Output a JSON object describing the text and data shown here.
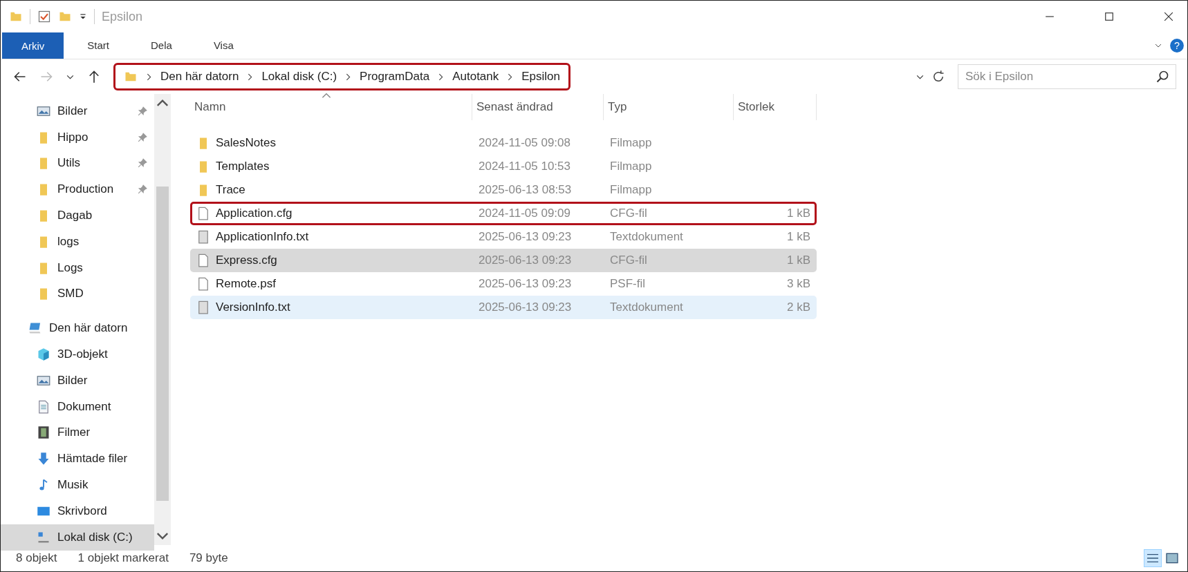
{
  "window": {
    "title": "Epsilon"
  },
  "ribbon": {
    "help": "?",
    "tabs": [
      {
        "label": "Arkiv",
        "selected": true
      },
      {
        "label": "Start",
        "selected": false
      },
      {
        "label": "Dela",
        "selected": false
      },
      {
        "label": "Visa",
        "selected": false
      }
    ]
  },
  "address_bar": {
    "annotated": true,
    "path": [
      "Den här datorn",
      "Lokal disk (C:)",
      "ProgramData",
      "Autotank",
      "Epsilon"
    ]
  },
  "search": {
    "placeholder": "Sök i Epsilon"
  },
  "sidebar": {
    "quick_access": [
      {
        "label": "Bilder",
        "kind": "pictures",
        "pinned": true,
        "selected": false
      },
      {
        "label": "Hippo",
        "kind": "folder",
        "pinned": true,
        "selected": false
      },
      {
        "label": "Utils",
        "kind": "folder",
        "pinned": true,
        "selected": false
      },
      {
        "label": "Production",
        "kind": "folder",
        "pinned": true,
        "selected": false
      },
      {
        "label": "Dagab",
        "kind": "folder",
        "pinned": false,
        "selected": false
      },
      {
        "label": "logs",
        "kind": "folder",
        "pinned": false,
        "selected": false
      },
      {
        "label": "Logs",
        "kind": "folder",
        "pinned": false,
        "selected": false
      },
      {
        "label": "SMD",
        "kind": "folder",
        "pinned": false,
        "selected": false
      }
    ],
    "this_pc": {
      "label": "Den här datorn",
      "children": [
        {
          "label": "3D-objekt",
          "kind": "cube",
          "selected": false
        },
        {
          "label": "Bilder",
          "kind": "pictures",
          "selected": false
        },
        {
          "label": "Dokument",
          "kind": "document",
          "selected": false
        },
        {
          "label": "Filmer",
          "kind": "film",
          "selected": false
        },
        {
          "label": "Hämtade filer",
          "kind": "download",
          "selected": false
        },
        {
          "label": "Musik",
          "kind": "music",
          "selected": false
        },
        {
          "label": "Skrivbord",
          "kind": "desktop",
          "selected": false
        },
        {
          "label": "Lokal disk (C:)",
          "kind": "drive",
          "selected": true
        }
      ]
    }
  },
  "table": {
    "columns": [
      "Namn",
      "Senast ändrad",
      "Typ",
      "Storlek"
    ],
    "rows": [
      {
        "name": "SalesNotes",
        "modified": "2024-11-05 09:08",
        "type": "Filmapp",
        "size": "",
        "kind": "folder",
        "selected": false,
        "hovered": false,
        "annotated": false
      },
      {
        "name": "Templates",
        "modified": "2024-11-05 10:53",
        "type": "Filmapp",
        "size": "",
        "kind": "folder",
        "selected": false,
        "hovered": false,
        "annotated": false
      },
      {
        "name": "Trace",
        "modified": "2025-06-13 08:53",
        "type": "Filmapp",
        "size": "",
        "kind": "folder",
        "selected": false,
        "hovered": false,
        "annotated": false
      },
      {
        "name": "Application.cfg",
        "modified": "2024-11-05 09:09",
        "type": "CFG-fil",
        "size": "1 kB",
        "kind": "file",
        "selected": false,
        "hovered": false,
        "annotated": true
      },
      {
        "name": "ApplicationInfo.txt",
        "modified": "2025-06-13 09:23",
        "type": "Textdokument",
        "size": "1 kB",
        "kind": "text",
        "selected": false,
        "hovered": false,
        "annotated": false
      },
      {
        "name": "Express.cfg",
        "modified": "2025-06-13 09:23",
        "type": "CFG-fil",
        "size": "1 kB",
        "kind": "file",
        "selected": true,
        "hovered": false,
        "annotated": false
      },
      {
        "name": "Remote.psf",
        "modified": "2025-06-13 09:23",
        "type": "PSF-fil",
        "size": "3 kB",
        "kind": "file",
        "selected": false,
        "hovered": false,
        "annotated": false
      },
      {
        "name": "VersionInfo.txt",
        "modified": "2025-06-13 09:23",
        "type": "Textdokument",
        "size": "2 kB",
        "kind": "text",
        "selected": false,
        "hovered": true,
        "annotated": false
      }
    ]
  },
  "status_bar": {
    "count": "8 objekt",
    "selection": "1 objekt markerat",
    "size": "79 byte"
  }
}
